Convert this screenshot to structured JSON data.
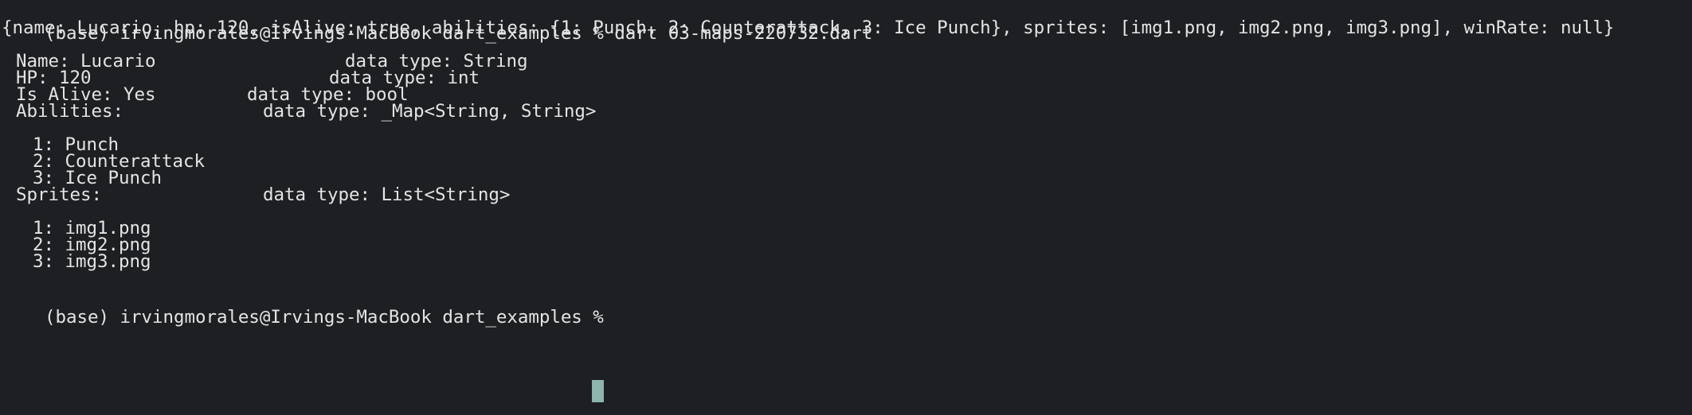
{
  "terminal": {
    "prompt": "(base) irvingmorales@Irvings-MacBook dart_examples % ",
    "command": "dart 03-maps-220732.dart",
    "map_output": "{name: Lucario, hp: 120, isAlive: true, abilities: {1: Punch, 2: Counterattack, 3: Ice Punch}, sprites: [img1.png, img2.png, img3.png], winRate: null}",
    "fields": [
      {
        "label": "Name: Lucario",
        "type": "data type: String"
      },
      {
        "label": "HP: 120",
        "type": "data type: int"
      },
      {
        "label": "Is Alive: Yes",
        "type": "data type: bool"
      },
      {
        "label": "Abilities:",
        "type": "data type: _Map<String, String>"
      }
    ],
    "abilities": [
      "1: Punch",
      "2: Counterattack",
      "3: Ice Punch"
    ],
    "sprites_field": {
      "label": "Sprites:",
      "type": "data type: List<String>"
    },
    "sprites": [
      "1: img1.png",
      "2: img2.png",
      "3: img3.png"
    ],
    "final_prompt": "(base) irvingmorales@Irvings-MacBook dart_examples % "
  },
  "colors": {
    "background": "#1d1f23",
    "text": "#e4e4e4",
    "cursor": "#8fb3ad"
  }
}
